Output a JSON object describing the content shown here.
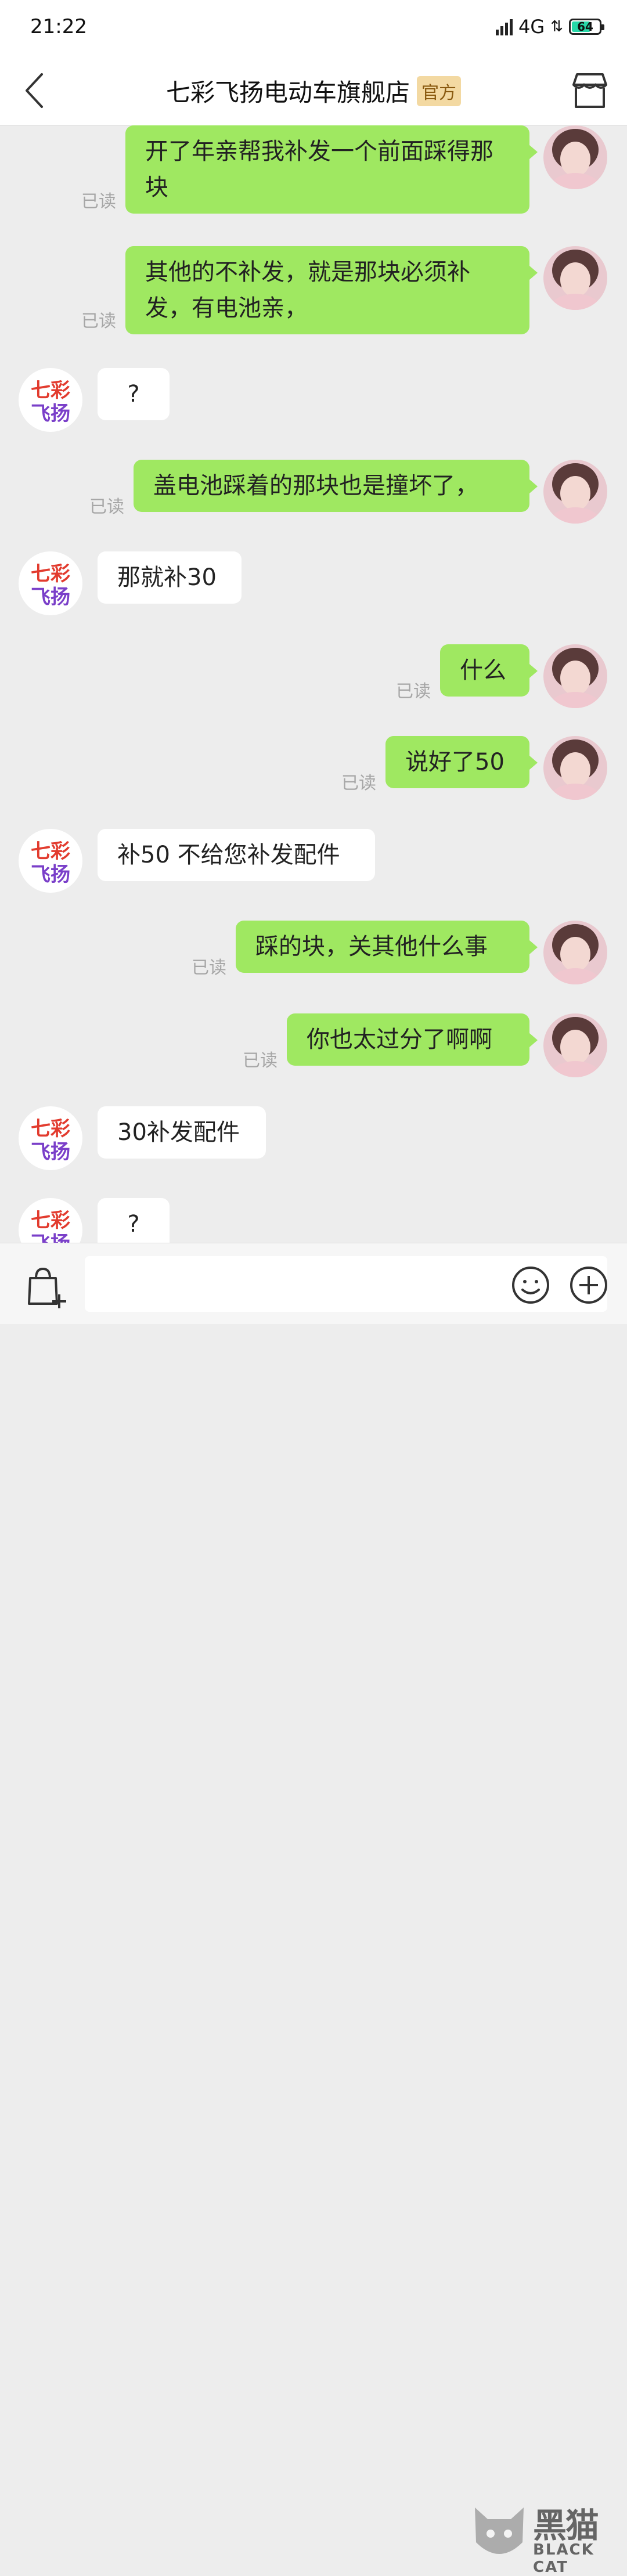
{
  "status_bar": {
    "time": "21:22",
    "network": "4G",
    "battery": "64"
  },
  "header": {
    "title": "七彩飞扬电动车旗舰店",
    "badge": "官方"
  },
  "shop_logo": {
    "line1": "七彩",
    "line2": "飞扬"
  },
  "messages": [
    {
      "side": "out",
      "text": "开了年亲帮我补发一个前面踩得那块",
      "read": "已读"
    },
    {
      "side": "out",
      "text": "其他的不补发，就是那块必须补发，有电池亲，",
      "read": "已读"
    },
    {
      "side": "in",
      "text": "?"
    },
    {
      "side": "out",
      "text": "盖电池踩着的那块也是撞坏了，",
      "read": "已读"
    },
    {
      "side": "in",
      "text": "那就补30"
    },
    {
      "side": "out",
      "text": "什么",
      "read": "已读"
    },
    {
      "side": "out",
      "text": "说好了50",
      "read": "已读"
    },
    {
      "side": "in",
      "text": "补50 不给您补发配件"
    },
    {
      "side": "out",
      "text": "踩的块，关其他什么事",
      "read": "已读"
    },
    {
      "side": "out",
      "text": "你也太过分了啊啊",
      "read": "已读"
    },
    {
      "side": "in",
      "text": "30补发配件"
    },
    {
      "side": "in",
      "text": "?"
    }
  ],
  "watermark": {
    "cn": "黑猫",
    "en": "BLACK CAT"
  },
  "colors": {
    "outgoing_bubble": "#9fe861",
    "incoming_bubble": "#ffffff",
    "background": "#ededed",
    "battery": "#27d7a8",
    "official_badge": "#f3d9a2"
  }
}
